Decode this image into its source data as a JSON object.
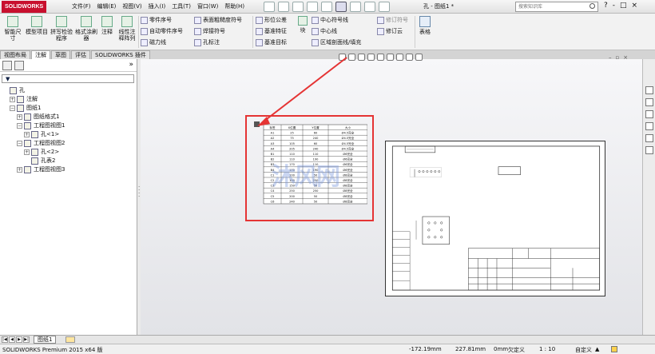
{
  "app": {
    "logo_text": "SOLIDWORKS",
    "document_title": "孔 - 图纸1 *"
  },
  "menu": [
    "文件(F)",
    "编辑(E)",
    "视图(V)",
    "插入(I)",
    "工具(T)",
    "窗口(W)",
    "帮助(H)"
  ],
  "search": {
    "placeholder": "搜索知识库"
  },
  "window_controls": [
    "?",
    "-",
    "□",
    "×"
  ],
  "ribbon": {
    "big": [
      "智能尺寸",
      "模型项目",
      "拼写检验程序",
      "格式涂刷器",
      "注释",
      "线性注释阵列",
      "块",
      "表格"
    ],
    "col1": [
      "零件序号",
      "自动零件序号",
      "磁力线"
    ],
    "col2": [
      "表面粗糙度符号",
      "焊接符号",
      "孔标注"
    ],
    "col3": [
      "形位公差",
      "基准特征",
      "基准目标"
    ],
    "col4": [
      "中心符号线",
      "中心线",
      "区域剖面线/填充"
    ],
    "col5": [
      "修订符号",
      "修订云"
    ]
  },
  "tabs": [
    {
      "label": "视图布局",
      "active": false
    },
    {
      "label": "注解",
      "active": true
    },
    {
      "label": "草图",
      "active": false
    },
    {
      "label": "评估",
      "active": false
    },
    {
      "label": "SOLIDWORKS 插件",
      "active": false
    }
  ],
  "tree": [
    {
      "label": "孔",
      "level": 0,
      "expander": ""
    },
    {
      "label": "注解",
      "level": 1,
      "expander": "+"
    },
    {
      "label": "图纸1",
      "level": 1,
      "expander": "−"
    },
    {
      "label": "图纸格式1",
      "level": 2,
      "expander": "+"
    },
    {
      "label": "工程图视图1",
      "level": 2,
      "expander": "−"
    },
    {
      "label": "孔<1>",
      "level": 3,
      "expander": "+"
    },
    {
      "label": "工程图视图2",
      "level": 2,
      "expander": "−"
    },
    {
      "label": "孔<2>",
      "level": 3,
      "expander": "+"
    },
    {
      "label": "孔表2",
      "level": 3,
      "expander": ""
    },
    {
      "label": "工程图视图3",
      "level": 2,
      "expander": "+"
    }
  ],
  "hole_table": {
    "headers": [
      "标签",
      "X位置",
      "Y位置",
      "大小"
    ],
    "rows": [
      [
        "A1",
        "25",
        "60",
        "Ø4.5完全"
      ],
      [
        "A2",
        "75",
        "240",
        "Ø4.5完全"
      ],
      [
        "A3",
        "105",
        "60",
        "Ø4.5完全"
      ],
      [
        "A4",
        "205",
        "240",
        "Ø4.5完全"
      ],
      [
        "B1",
        "110",
        "110",
        "Ø6完全"
      ],
      [
        "B2",
        "110",
        "190",
        "Ø6完全"
      ],
      [
        "B3",
        "170",
        "110",
        "Ø6完全"
      ],
      [
        "B4",
        "170",
        "190",
        "Ø6完全"
      ],
      [
        "C1",
        "100",
        "50",
        "Ø8完全"
      ],
      [
        "C2",
        "100",
        "250",
        "Ø8完全"
      ],
      [
        "C3",
        "150",
        "50",
        "Ø8完全"
      ],
      [
        "C4",
        "250",
        "250",
        "Ø8完全"
      ],
      [
        "C5",
        "200",
        "50",
        "Ø8完全"
      ],
      [
        "C6",
        "240",
        "50",
        "Ø8完全"
      ]
    ]
  },
  "watermark": "沐风网",
  "sheet_tabs": [
    {
      "label": "图纸1"
    }
  ],
  "status": {
    "product": "SOLIDWORKS Premium 2015 x64 版",
    "x": "-172.19mm",
    "y": "227.81mm",
    "z": "0mm",
    "state": "欠定义",
    "scale": "1 : 10",
    "units": "自定义"
  },
  "colors": {
    "highlight": "#e53434",
    "accent": "#c8102e"
  }
}
